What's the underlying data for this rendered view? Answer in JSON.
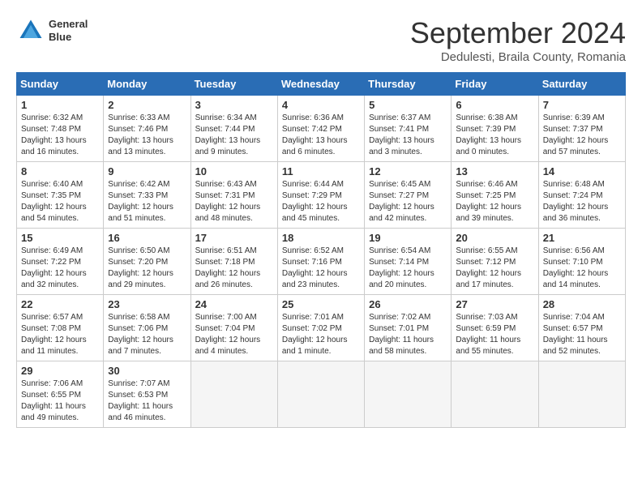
{
  "header": {
    "logo_line1": "General",
    "logo_line2": "Blue",
    "month": "September 2024",
    "location": "Dedulesti, Braila County, Romania"
  },
  "weekdays": [
    "Sunday",
    "Monday",
    "Tuesday",
    "Wednesday",
    "Thursday",
    "Friday",
    "Saturday"
  ],
  "weeks": [
    [
      {
        "day": "1",
        "lines": [
          "Sunrise: 6:32 AM",
          "Sunset: 7:48 PM",
          "Daylight: 13 hours",
          "and 16 minutes."
        ]
      },
      {
        "day": "2",
        "lines": [
          "Sunrise: 6:33 AM",
          "Sunset: 7:46 PM",
          "Daylight: 13 hours",
          "and 13 minutes."
        ]
      },
      {
        "day": "3",
        "lines": [
          "Sunrise: 6:34 AM",
          "Sunset: 7:44 PM",
          "Daylight: 13 hours",
          "and 9 minutes."
        ]
      },
      {
        "day": "4",
        "lines": [
          "Sunrise: 6:36 AM",
          "Sunset: 7:42 PM",
          "Daylight: 13 hours",
          "and 6 minutes."
        ]
      },
      {
        "day": "5",
        "lines": [
          "Sunrise: 6:37 AM",
          "Sunset: 7:41 PM",
          "Daylight: 13 hours",
          "and 3 minutes."
        ]
      },
      {
        "day": "6",
        "lines": [
          "Sunrise: 6:38 AM",
          "Sunset: 7:39 PM",
          "Daylight: 13 hours",
          "and 0 minutes."
        ]
      },
      {
        "day": "7",
        "lines": [
          "Sunrise: 6:39 AM",
          "Sunset: 7:37 PM",
          "Daylight: 12 hours",
          "and 57 minutes."
        ]
      }
    ],
    [
      {
        "day": "8",
        "lines": [
          "Sunrise: 6:40 AM",
          "Sunset: 7:35 PM",
          "Daylight: 12 hours",
          "and 54 minutes."
        ]
      },
      {
        "day": "9",
        "lines": [
          "Sunrise: 6:42 AM",
          "Sunset: 7:33 PM",
          "Daylight: 12 hours",
          "and 51 minutes."
        ]
      },
      {
        "day": "10",
        "lines": [
          "Sunrise: 6:43 AM",
          "Sunset: 7:31 PM",
          "Daylight: 12 hours",
          "and 48 minutes."
        ]
      },
      {
        "day": "11",
        "lines": [
          "Sunrise: 6:44 AM",
          "Sunset: 7:29 PM",
          "Daylight: 12 hours",
          "and 45 minutes."
        ]
      },
      {
        "day": "12",
        "lines": [
          "Sunrise: 6:45 AM",
          "Sunset: 7:27 PM",
          "Daylight: 12 hours",
          "and 42 minutes."
        ]
      },
      {
        "day": "13",
        "lines": [
          "Sunrise: 6:46 AM",
          "Sunset: 7:25 PM",
          "Daylight: 12 hours",
          "and 39 minutes."
        ]
      },
      {
        "day": "14",
        "lines": [
          "Sunrise: 6:48 AM",
          "Sunset: 7:24 PM",
          "Daylight: 12 hours",
          "and 36 minutes."
        ]
      }
    ],
    [
      {
        "day": "15",
        "lines": [
          "Sunrise: 6:49 AM",
          "Sunset: 7:22 PM",
          "Daylight: 12 hours",
          "and 32 minutes."
        ]
      },
      {
        "day": "16",
        "lines": [
          "Sunrise: 6:50 AM",
          "Sunset: 7:20 PM",
          "Daylight: 12 hours",
          "and 29 minutes."
        ]
      },
      {
        "day": "17",
        "lines": [
          "Sunrise: 6:51 AM",
          "Sunset: 7:18 PM",
          "Daylight: 12 hours",
          "and 26 minutes."
        ]
      },
      {
        "day": "18",
        "lines": [
          "Sunrise: 6:52 AM",
          "Sunset: 7:16 PM",
          "Daylight: 12 hours",
          "and 23 minutes."
        ]
      },
      {
        "day": "19",
        "lines": [
          "Sunrise: 6:54 AM",
          "Sunset: 7:14 PM",
          "Daylight: 12 hours",
          "and 20 minutes."
        ]
      },
      {
        "day": "20",
        "lines": [
          "Sunrise: 6:55 AM",
          "Sunset: 7:12 PM",
          "Daylight: 12 hours",
          "and 17 minutes."
        ]
      },
      {
        "day": "21",
        "lines": [
          "Sunrise: 6:56 AM",
          "Sunset: 7:10 PM",
          "Daylight: 12 hours",
          "and 14 minutes."
        ]
      }
    ],
    [
      {
        "day": "22",
        "lines": [
          "Sunrise: 6:57 AM",
          "Sunset: 7:08 PM",
          "Daylight: 12 hours",
          "and 11 minutes."
        ]
      },
      {
        "day": "23",
        "lines": [
          "Sunrise: 6:58 AM",
          "Sunset: 7:06 PM",
          "Daylight: 12 hours",
          "and 7 minutes."
        ]
      },
      {
        "day": "24",
        "lines": [
          "Sunrise: 7:00 AM",
          "Sunset: 7:04 PM",
          "Daylight: 12 hours",
          "and 4 minutes."
        ]
      },
      {
        "day": "25",
        "lines": [
          "Sunrise: 7:01 AM",
          "Sunset: 7:02 PM",
          "Daylight: 12 hours",
          "and 1 minute."
        ]
      },
      {
        "day": "26",
        "lines": [
          "Sunrise: 7:02 AM",
          "Sunset: 7:01 PM",
          "Daylight: 11 hours",
          "and 58 minutes."
        ]
      },
      {
        "day": "27",
        "lines": [
          "Sunrise: 7:03 AM",
          "Sunset: 6:59 PM",
          "Daylight: 11 hours",
          "and 55 minutes."
        ]
      },
      {
        "day": "28",
        "lines": [
          "Sunrise: 7:04 AM",
          "Sunset: 6:57 PM",
          "Daylight: 11 hours",
          "and 52 minutes."
        ]
      }
    ],
    [
      {
        "day": "29",
        "lines": [
          "Sunrise: 7:06 AM",
          "Sunset: 6:55 PM",
          "Daylight: 11 hours",
          "and 49 minutes."
        ]
      },
      {
        "day": "30",
        "lines": [
          "Sunrise: 7:07 AM",
          "Sunset: 6:53 PM",
          "Daylight: 11 hours",
          "and 46 minutes."
        ]
      },
      {
        "day": "",
        "lines": [],
        "empty": true
      },
      {
        "day": "",
        "lines": [],
        "empty": true
      },
      {
        "day": "",
        "lines": [],
        "empty": true
      },
      {
        "day": "",
        "lines": [],
        "empty": true
      },
      {
        "day": "",
        "lines": [],
        "empty": true
      }
    ]
  ]
}
